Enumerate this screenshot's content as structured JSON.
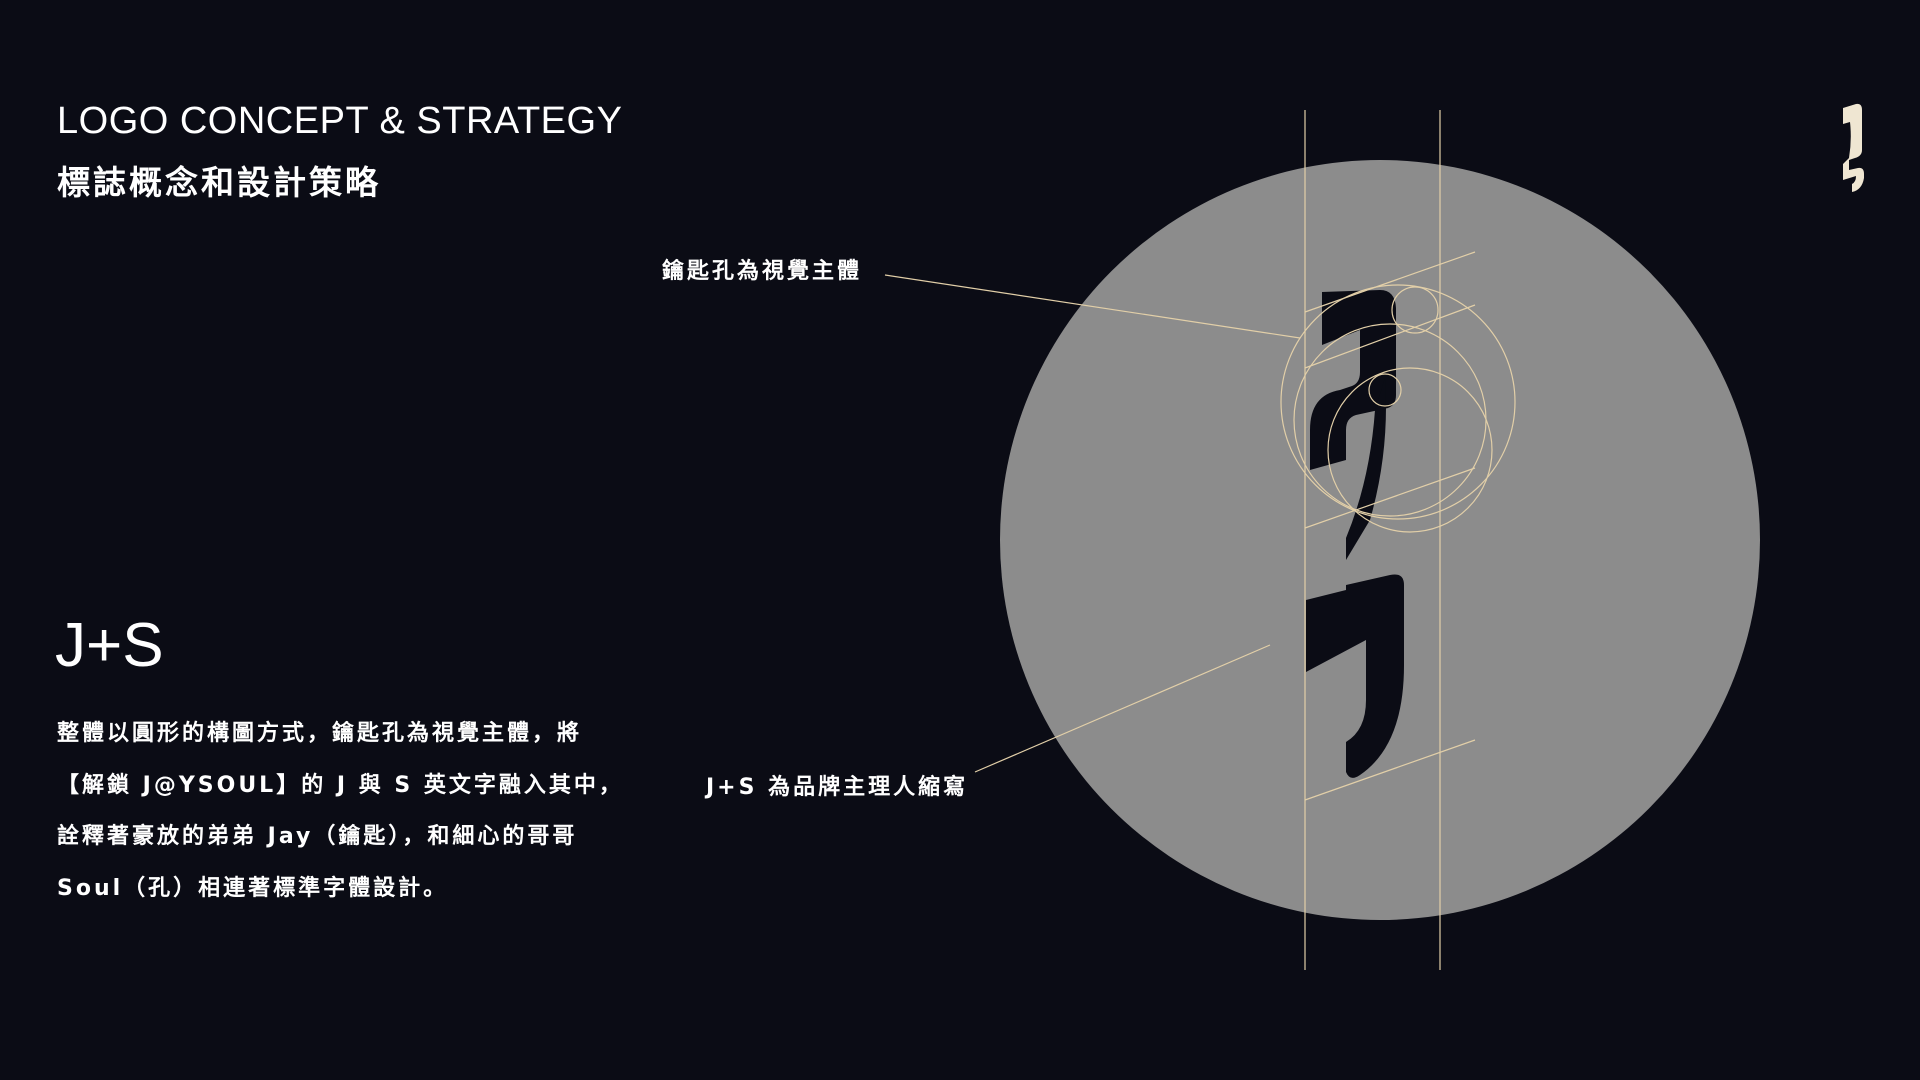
{
  "header": {
    "title_en": "LOGO CONCEPT & STRATEGY",
    "title_zh": "標誌概念和設計策略"
  },
  "concept": {
    "heading": "J+S",
    "description_lines": [
      "整體以圓形的構圖方式，鑰匙孔為視覺主體，將",
      "【解鎖 J@YSOUL】的 J 與 S 英文字融入其中，",
      "詮釋著豪放的弟弟 Jay（鑰匙），和細心的哥哥",
      "Soul（孔）相連著標準字體設計。"
    ]
  },
  "callouts": {
    "top": "鑰匙孔為視覺主體",
    "bottom": "J+S 為品牌主理人縮寫"
  },
  "colors": {
    "background": "#0b0c15",
    "circle": "#8c8c8c",
    "logo_dark": "#0b0c15",
    "guide_lines": "#e2cfa8",
    "logo_mark_small": "#efe6d2",
    "text": "#ffffff"
  },
  "icons": {
    "corner_logo": "js-keyhole-logo-icon",
    "main_logo": "js-keyhole-logo-icon"
  }
}
